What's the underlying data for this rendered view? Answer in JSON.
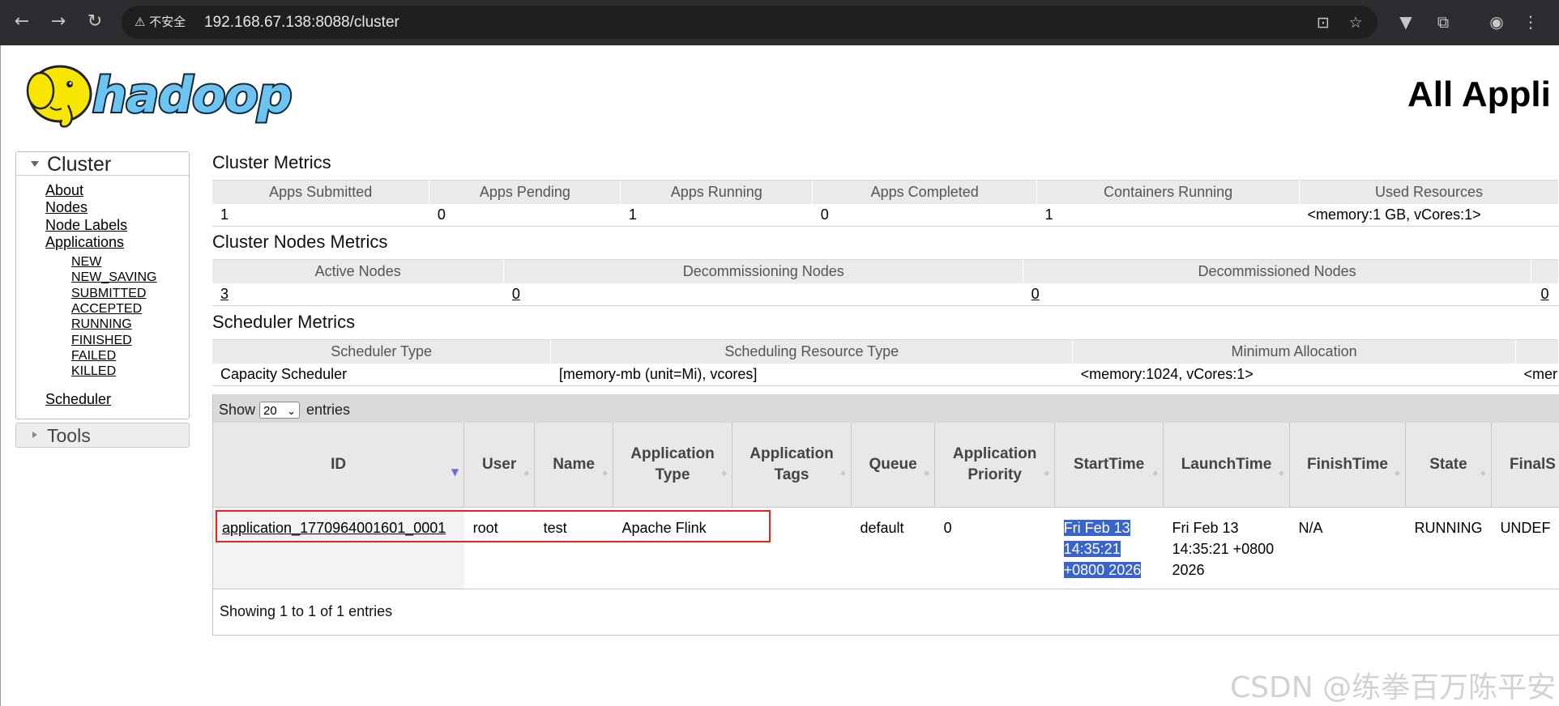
{
  "browser": {
    "back_icon": "arrow-left-icon",
    "forward_icon": "arrow-right-icon",
    "reload_icon": "reload-icon",
    "security_label": "不安全",
    "url": "192.168.67.138:8088/cluster"
  },
  "page_title": "All Appli",
  "sidebar": {
    "cluster_label": "Cluster",
    "links": [
      "About",
      "Nodes",
      "Node Labels",
      "Applications"
    ],
    "app_states": [
      "NEW",
      "NEW_SAVING",
      "SUBMITTED",
      "ACCEPTED",
      "RUNNING",
      "FINISHED",
      "FAILED",
      "KILLED"
    ],
    "scheduler_label": "Scheduler",
    "tools_label": "Tools"
  },
  "cluster_metrics": {
    "title": "Cluster Metrics",
    "headers": [
      "Apps Submitted",
      "Apps Pending",
      "Apps Running",
      "Apps Completed",
      "Containers Running",
      "Used Resources"
    ],
    "values": [
      "1",
      "0",
      "1",
      "0",
      "1",
      "<memory:1 GB, vCores:1>"
    ]
  },
  "nodes_metrics": {
    "title": "Cluster Nodes Metrics",
    "headers": [
      "Active Nodes",
      "Decommissioning Nodes",
      "Decommissioned Nodes"
    ],
    "values": [
      "3",
      "0",
      "0",
      "0"
    ]
  },
  "scheduler_metrics": {
    "title": "Scheduler Metrics",
    "headers": [
      "Scheduler Type",
      "Scheduling Resource Type",
      "Minimum Allocation"
    ],
    "values": [
      "Capacity Scheduler",
      "[memory-mb (unit=Mi), vcores]",
      "<memory:1024, vCores:1>",
      "<mer"
    ]
  },
  "apps": {
    "show_label": "Show",
    "entries_label": "entries",
    "page_size": "20",
    "headers": {
      "id": "ID",
      "user": "User",
      "name": "Name",
      "app_type_1": "Application",
      "app_type_2": "Type",
      "app_tags_1": "Application",
      "app_tags_2": "Tags",
      "queue": "Queue",
      "priority_1": "Application",
      "priority_2": "Priority",
      "start": "StartTime",
      "launch": "LaunchTime",
      "finish": "FinishTime",
      "state": "State",
      "final": "FinalS"
    },
    "row": {
      "id": "application_1770964001601_0001",
      "user": "root",
      "name": "test",
      "type": "Apache Flink",
      "tags": "",
      "queue": "default",
      "priority": "0",
      "start_l1": "Fri Feb 13",
      "start_l2": "14:35:21",
      "start_l3": "+0800 2026",
      "launch_l1": "Fri Feb 13",
      "launch_l2": "14:35:21 +0800",
      "launch_l3": "2026",
      "finish": "N/A",
      "state": "RUNNING",
      "final": "UNDEF"
    },
    "info": "Showing 1 to 1 of 1 entries"
  },
  "watermark": "CSDN @练拳百万陈平安"
}
